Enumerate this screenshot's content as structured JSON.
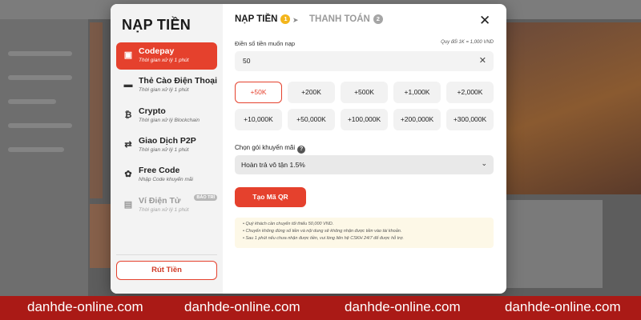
{
  "modal": {
    "title": "NẠP TIỀN",
    "close_icon": "close-icon",
    "steps": [
      {
        "label": "NẠP TIỀN",
        "number": "1"
      },
      {
        "label": "THANH TOÁN",
        "number": "2"
      }
    ],
    "accent_color": "#e5412d"
  },
  "sidebar": {
    "items": [
      {
        "label": "Codepay",
        "sub": "Thời gian xử lý 1 phút",
        "icon": "wallet-icon",
        "active": true
      },
      {
        "label": "Thẻ Cào Điện Thoại",
        "sub": "Thời gian xử lý 1 phút",
        "icon": "card-icon"
      },
      {
        "label": "Crypto",
        "sub": "Thời gian xử lý Blockchain",
        "icon": "bitcoin-icon"
      },
      {
        "label": "Giao Dịch P2P",
        "sub": "Thời gian xử lý 1 phút",
        "icon": "p2p-icon"
      },
      {
        "label": "Free Code",
        "sub": "Nhập Code khuyến mãi",
        "icon": "gift-icon"
      },
      {
        "label": "Ví Điện Tử",
        "sub": "Thời gian xử lý 1 phút",
        "icon": "ewallet-icon",
        "badge": "BẢO TRÌ",
        "disabled": true
      }
    ],
    "withdraw_label": "Rút Tiền"
  },
  "form": {
    "amount_label": "Điền số tiền muốn nạp",
    "rate_note": "Quy đổi 1K = 1,000 VND",
    "amount_value": "50",
    "quick_amounts": [
      "+50K",
      "+200K",
      "+500K",
      "+1,000K",
      "+2,000K",
      "+10,000K",
      "+50,000K",
      "+100,000K",
      "+200,000K",
      "+300,000K"
    ],
    "selected_amount": "+50K",
    "promo_label": "Chọn gói khuyến mãi",
    "promo_value": "Hoàn trả vô tận 1.5%",
    "submit_label": "Tạo Mã QR",
    "notes": [
      "Quý khách cần chuyển tối thiểu 50,000 VND.",
      "Chuyển không đúng số tiền và nội dung sẽ không nhận được tiền vào tài khoản.",
      "Sau 1 phút nếu chưa nhận được tiền, vui lòng liên hệ CSKH 24/7 để được hỗ trợ."
    ]
  },
  "footer": {
    "watermarks": [
      "danhde-online.com",
      "danhde-online.com",
      "danhde-online.com",
      "danhde-online.com"
    ],
    "color": "#aa1a16"
  }
}
